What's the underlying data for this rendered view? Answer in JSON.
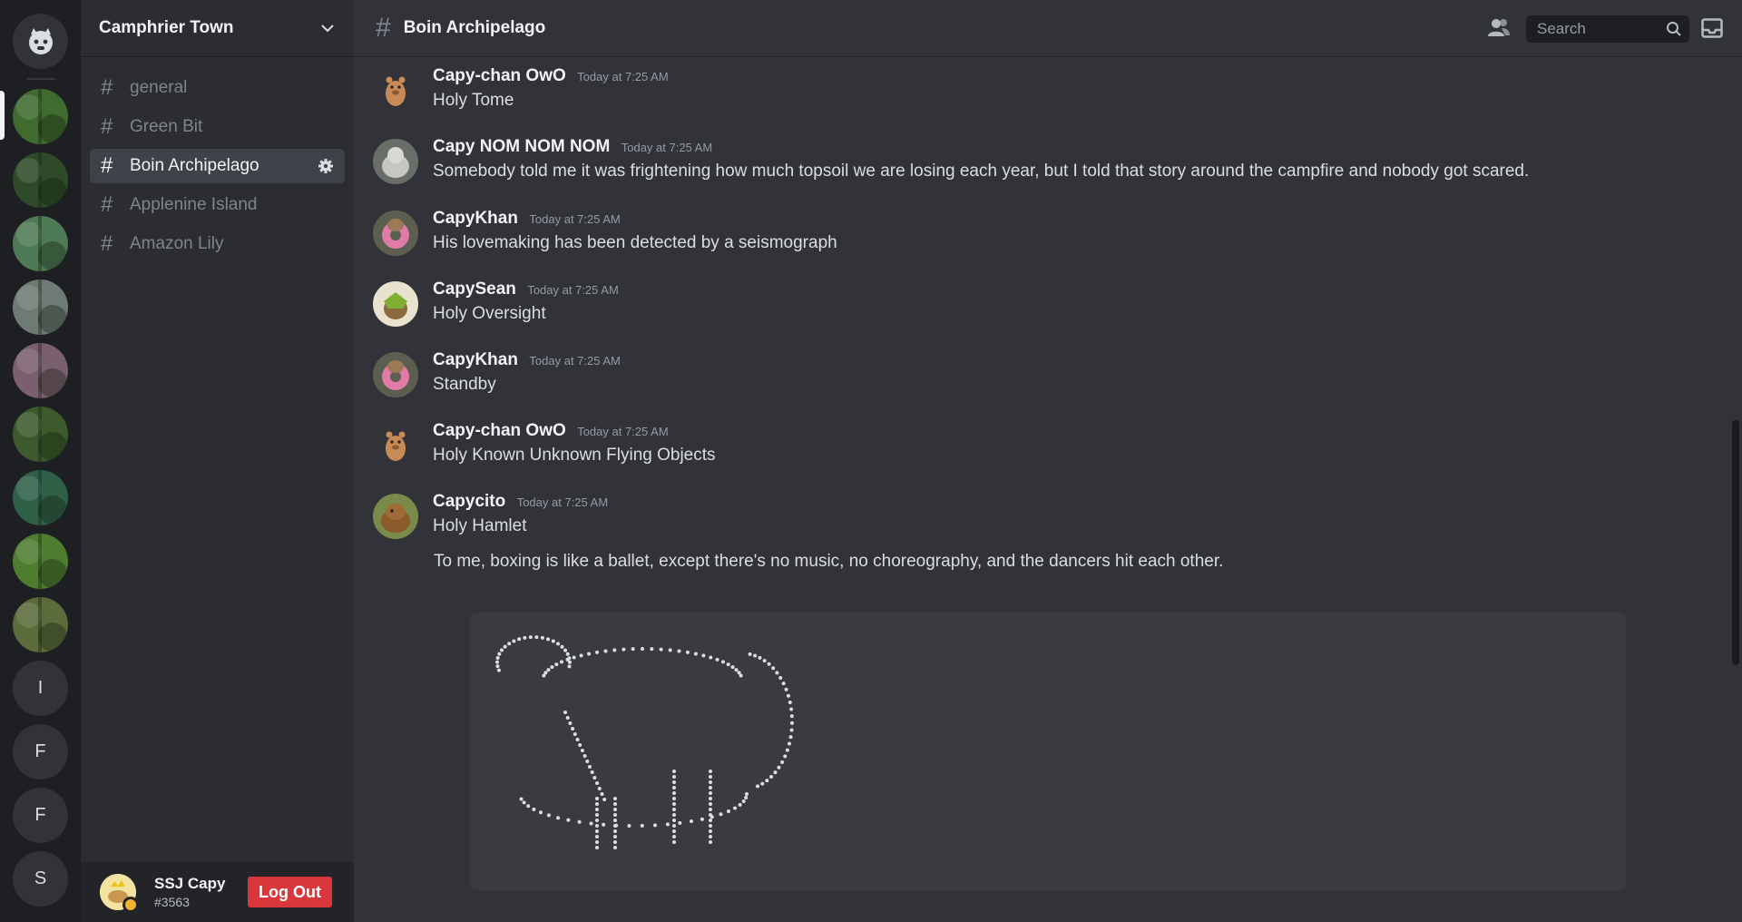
{
  "server_rail": {
    "servers": [
      {
        "kind": "image",
        "color": "#3f6b2f"
      },
      {
        "kind": "image",
        "color": "#2e4a28"
      },
      {
        "kind": "image",
        "color": "#4e7a55"
      },
      {
        "kind": "image",
        "color": "#6e7a74"
      },
      {
        "kind": "image",
        "color": "#7a5f6e"
      },
      {
        "kind": "image",
        "color": "#3d5a2c"
      },
      {
        "kind": "image",
        "color": "#2e6048"
      },
      {
        "kind": "image",
        "color": "#4f7d30"
      },
      {
        "kind": "image",
        "color": "#5b6b3a"
      },
      {
        "kind": "letter",
        "letter": "I"
      },
      {
        "kind": "letter",
        "letter": "F"
      },
      {
        "kind": "letter",
        "letter": "F"
      },
      {
        "kind": "letter",
        "letter": "S"
      }
    ]
  },
  "sidebar": {
    "guild_name": "Camphrier Town",
    "channels": [
      {
        "name": "general",
        "active": false
      },
      {
        "name": "Green Bit",
        "active": false
      },
      {
        "name": "Boin Archipelago",
        "active": true
      },
      {
        "name": "Applenine Island",
        "active": false
      },
      {
        "name": "Amazon Lily",
        "active": false
      }
    ],
    "user": {
      "name": "SSJ Capy",
      "tag": "#3563",
      "logout_label": "Log Out"
    }
  },
  "topbar": {
    "channel_title": "Boin Archipelago",
    "search_placeholder": "Search"
  },
  "messages": [
    {
      "author": "Capy-chan OwO",
      "time": "Today at 7:25 AM",
      "text": "Holy Tome",
      "avatar": "capy-cartoon"
    },
    {
      "author": "Capy NOM NOM NOM",
      "time": "Today at 7:25 AM",
      "text": "Somebody told me it was frightening how much topsoil we are losing each year, but I told that story around the campfire and nobody got scared.",
      "avatar": "photo-grey"
    },
    {
      "author": "CapyKhan",
      "time": "Today at 7:25 AM",
      "text": "His lovemaking has been detected by a seismograph",
      "avatar": "photo-pink"
    },
    {
      "author": "CapySean",
      "time": "Today at 7:25 AM",
      "text": "Holy Oversight",
      "avatar": "photo-green"
    },
    {
      "author": "CapyKhan",
      "time": "Today at 7:25 AM",
      "text": "Standby",
      "avatar": "photo-pink"
    },
    {
      "author": "Capy-chan OwO",
      "time": "Today at 7:25 AM",
      "text": "Holy Known Unknown Flying Objects",
      "avatar": "capy-cartoon"
    },
    {
      "author": "Capycito",
      "time": "Today at 7:25 AM",
      "text": "Holy Hamlet",
      "avatar": "photo-brown"
    }
  ],
  "continuation_text": "To me, boxing is like a ballet, except there's no music, no choreography, and the dancers hit each other.",
  "colors": {
    "logout": "#da373c",
    "status_idle": "#f0b232",
    "active_channel": "#404249"
  }
}
